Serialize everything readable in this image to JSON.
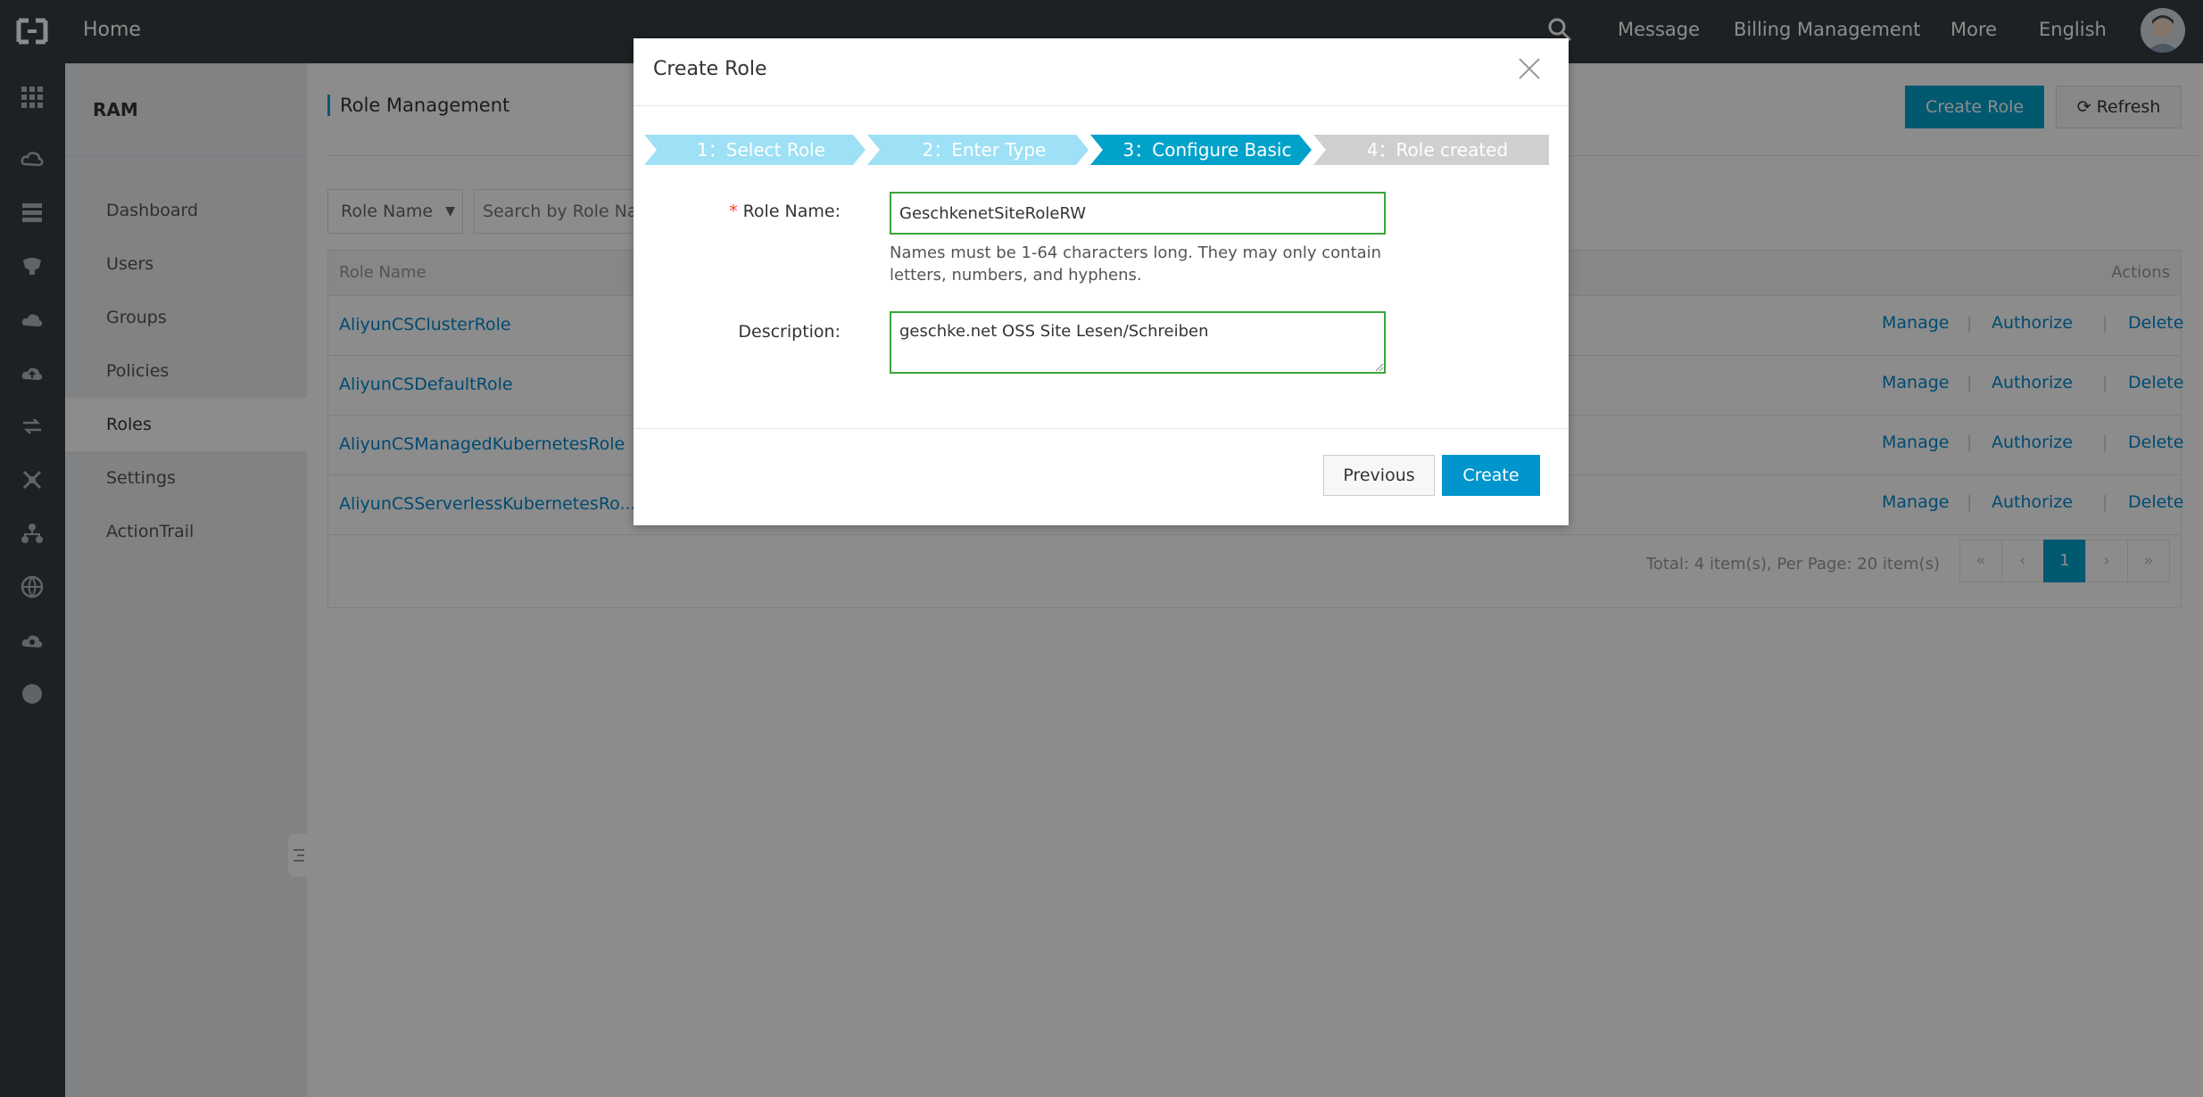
{
  "topbar": {
    "home": "Home",
    "links": [
      "Message",
      "Billing Management",
      "More",
      "English"
    ]
  },
  "rail": {
    "icons": [
      "grid-icon",
      "cloud-server-icon",
      "database-icon",
      "storage-icon",
      "cloud-icon",
      "cloud-upload-icon",
      "network-icon",
      "cluster-icon",
      "hierarchy-icon",
      "globe-icon",
      "cloud-cog-icon",
      "circle-icon"
    ]
  },
  "sidebar": {
    "title": "RAM",
    "items": [
      {
        "label": "Dashboard"
      },
      {
        "label": "Users"
      },
      {
        "label": "Groups"
      },
      {
        "label": "Policies"
      },
      {
        "label": "Roles",
        "active": true
      },
      {
        "label": "Settings"
      },
      {
        "label": "ActionTrail"
      }
    ]
  },
  "main": {
    "title": "Role Management",
    "create_role_label": "Create Role",
    "refresh_label": "Refresh",
    "filter_select": "Role Name",
    "search_placeholder": "Search by Role Name",
    "table": {
      "col_name": "Role Name",
      "col_actions": "Actions",
      "rows": [
        {
          "name": "AliyunCSClusterRole"
        },
        {
          "name": "AliyunCSDefaultRole"
        },
        {
          "name": "AliyunCSManagedKubernetesRole"
        },
        {
          "name": "AliyunCSServerlessKubernetesRo..."
        }
      ],
      "actions": {
        "manage": "Manage",
        "authorize": "Authorize",
        "delete": "Delete",
        "sep": "|"
      }
    },
    "pager": {
      "total_text": "Total: 4 item(s), Per Page: 20 item(s)",
      "first": "«",
      "prev": "‹",
      "current": "1",
      "next": "›",
      "last": "»"
    }
  },
  "modal": {
    "title": "Create Role",
    "steps": [
      {
        "label": "1：Select Role",
        "state": "done"
      },
      {
        "label": "2：Enter Type",
        "state": "done"
      },
      {
        "label": "3：Configure Basic",
        "state": "active"
      },
      {
        "label": "4：Role created",
        "state": "pending"
      }
    ],
    "role_name_label": "Role Name:",
    "required_mark": "*",
    "role_name_value": "GeschkenetSiteRoleRW",
    "hint": "Names must be 1-64 characters long. They may only contain letters, numbers, and hyphens.",
    "description_label": "Description:",
    "description_value": "geschke.net OSS Site Lesen/Schreiben",
    "previous_label": "Previous",
    "create_label": "Create"
  },
  "colors": {
    "accent": "#00a2ca",
    "link": "#0088cc",
    "topbar": "#373d41",
    "step_done": "#9ee0f5",
    "step_active": "#00a2ca",
    "step_pending": "#cfcfcf",
    "valid_border": "#3ba53b"
  }
}
